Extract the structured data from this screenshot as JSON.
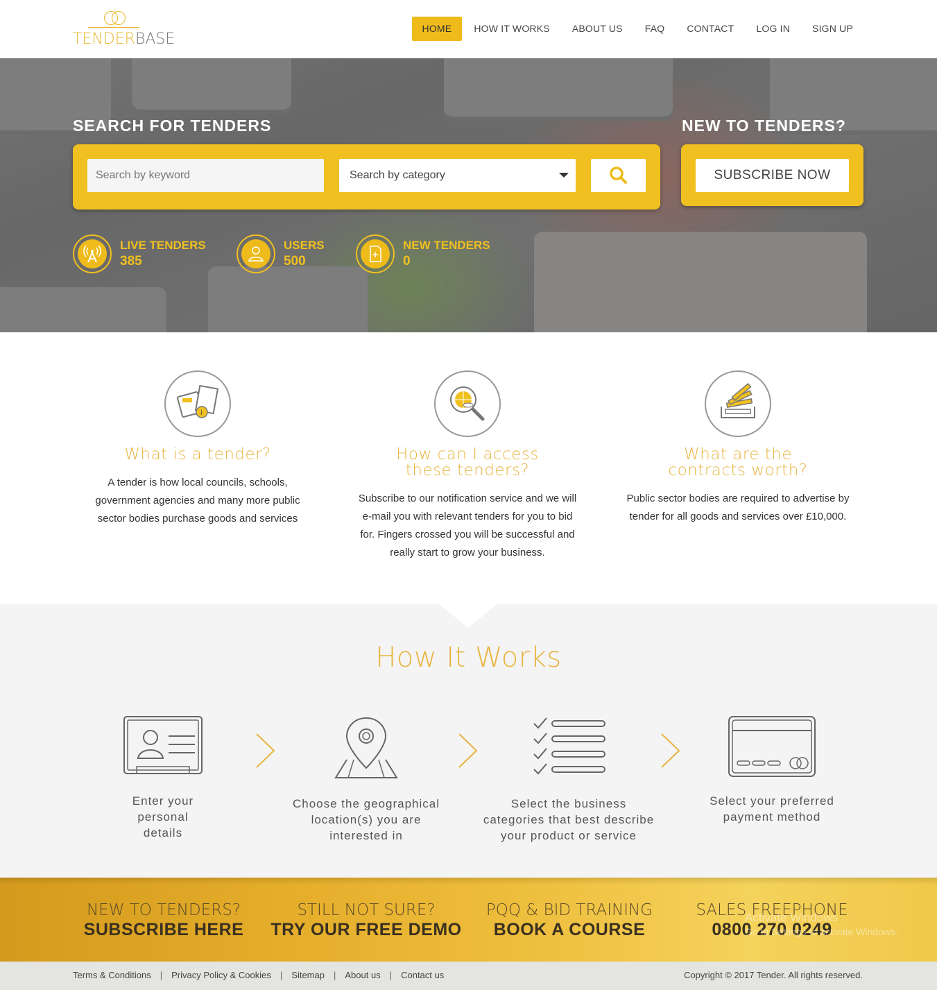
{
  "brand": {
    "part1": "TENDER",
    "part2": "BASE",
    "accent": "#eebb1a"
  },
  "nav": [
    "HOME",
    "HOW IT WORKS",
    "ABOUT US",
    "FAQ",
    "CONTACT",
    "LOG IN",
    "SIGN UP"
  ],
  "hero": {
    "search_title": "SEARCH FOR TENDERS",
    "keyword_placeholder": "Search by keyword",
    "category_value": "Search by category",
    "new_title": "NEW TO TENDERS?",
    "subscribe_label": "SUBSCRIBE NOW",
    "stats": [
      {
        "label": "LIVE TENDERS",
        "value": "385",
        "icon": "broadcast-icon"
      },
      {
        "label": "USERS",
        "value": "500",
        "icon": "user-icon"
      },
      {
        "label": "NEW TENDERS",
        "value": "0",
        "icon": "new-document-icon"
      }
    ]
  },
  "info": [
    {
      "title": "What is a tender?",
      "text": "A tender is how local councils, schools, government agencies and many more public sector bodies purchase goods and services",
      "icon": "documents-icon"
    },
    {
      "title": "How can I access these tenders?",
      "text": "Subscribe to our notification service and we will e-mail you with relevant tenders for you to bid for. Fingers crossed you will be successful and really start to grow your business.",
      "icon": "magnifier-globe-icon"
    },
    {
      "title": "What are the contracts worth?",
      "text": "Public sector bodies are required to advertise by tender for all goods and services over £10,000.",
      "icon": "money-tray-icon"
    }
  ],
  "how": {
    "title": "How It Works",
    "steps": [
      {
        "text": "Enter your personal details",
        "icon": "id-card-icon"
      },
      {
        "text": "Choose the geographical location(s) you are interested in",
        "icon": "map-pin-icon"
      },
      {
        "text": "Select the business categories that best describe your product or service",
        "icon": "checklist-icon"
      },
      {
        "text": "Select your preferred payment method",
        "icon": "credit-card-icon"
      }
    ]
  },
  "cta": [
    {
      "small": "NEW TO TENDERS?",
      "big": "SUBSCRIBE HERE"
    },
    {
      "small": "STILL NOT SURE?",
      "big": "TRY OUR FREE DEMO"
    },
    {
      "small": "PQQ & BID TRAINING",
      "big": "BOOK A COURSE"
    },
    {
      "small": "SALES FREEPHONE",
      "big": "0800 270 0249"
    }
  ],
  "watermark": {
    "line1": "Activate Windows",
    "line2": "Go to Settings to activate Windows."
  },
  "footer": {
    "links": [
      "Terms & Conditions",
      "Privacy Policy & Cookies",
      "Sitemap",
      "About us",
      "Contact us"
    ],
    "copyright": "Copyright © 2017 Tender. All rights reserved."
  }
}
